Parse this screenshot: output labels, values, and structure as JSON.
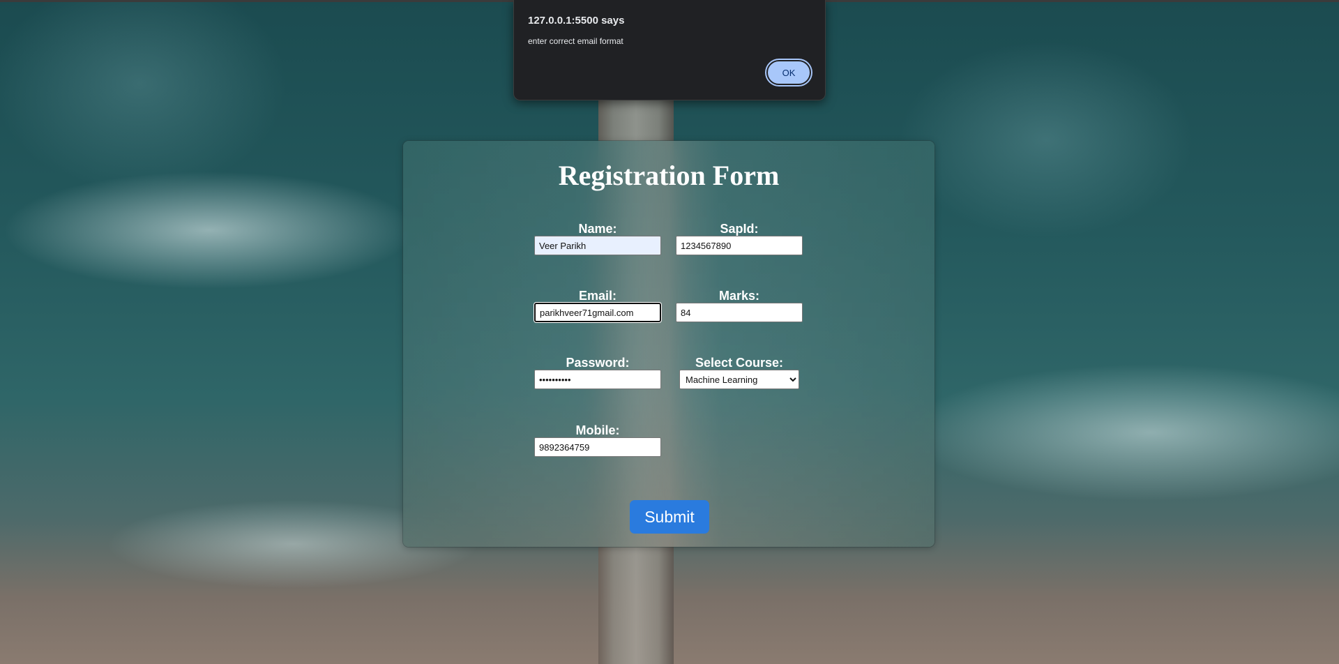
{
  "dialog": {
    "origin": "127.0.0.1:5500 says",
    "message": "enter correct email format",
    "ok_label": "OK"
  },
  "form": {
    "title": "Registration Form",
    "name": {
      "label": "Name:",
      "value": "Veer Parikh"
    },
    "sapid": {
      "label": "SapId:",
      "value": "1234567890"
    },
    "email": {
      "label": "Email:",
      "value": "parikhveer71gmail.com"
    },
    "marks": {
      "label": "Marks:",
      "value": "84"
    },
    "password": {
      "label": "Password:",
      "value": "••••••••••"
    },
    "course": {
      "label": "Select Course:",
      "selected": "Machine Learning"
    },
    "mobile": {
      "label": "Mobile:",
      "value": "9892364759"
    },
    "submit_label": "Submit"
  },
  "colors": {
    "submit_bg": "#2a7bde",
    "dialog_bg": "#202124",
    "ok_bg": "#a8c7fa"
  }
}
